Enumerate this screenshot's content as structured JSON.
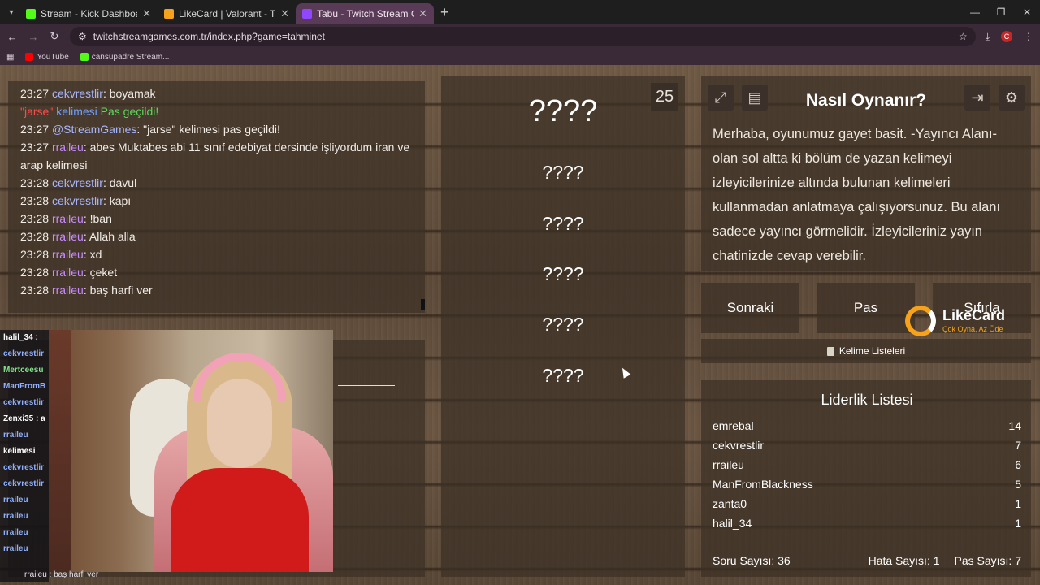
{
  "browser": {
    "tabs": [
      {
        "title": "Stream - Kick Dashboard",
        "favicon_color": "#53fc18"
      },
      {
        "title": "LikeCard | Valorant - TR",
        "favicon_color": "#f6a21b"
      },
      {
        "title": "Tabu - Twitch Stream Games",
        "favicon_color": "#9146ff"
      }
    ],
    "url": "twitchstreamgames.com.tr/index.php?game=tahminet",
    "bookmarks": [
      {
        "label": "YouTube",
        "favicon_color": "#ff0000"
      },
      {
        "label": "cansupadre Stream...",
        "favicon_color": "#53fc18"
      }
    ],
    "avatar_letter": "C"
  },
  "chat": {
    "lines": [
      {
        "time": "23:27",
        "user": "cekvrestlir",
        "msg": ": boyamak"
      },
      {
        "time": "23:27",
        "user": "@StreamGames",
        "msg": ": \"jarse\" kelimesi pas geçildi!"
      },
      {
        "time": "23:27",
        "user": "rraileu",
        "msg": ": abes Muktabes abi 11 sınıf edebiyat dersinde işliyordum iran ve arap kelimesi"
      },
      {
        "time": "23:28",
        "user": "cekvrestlir",
        "msg": ": davul"
      },
      {
        "time": "23:28",
        "user": "cekvrestlir",
        "msg": ": kapı"
      },
      {
        "time": "23:28",
        "user": "rraileu",
        "msg": ": !ban"
      },
      {
        "time": "23:28",
        "user": "rraileu",
        "msg": ": Allah alla"
      },
      {
        "time": "23:28",
        "user": "rraileu",
        "msg": ": xd"
      },
      {
        "time": "23:28",
        "user": "rraileu",
        "msg": ": çeket"
      },
      {
        "time": "23:28",
        "user": "rraileu",
        "msg": ": baş harfi ver"
      }
    ],
    "notice": {
      "word": "\"jarse\"",
      "middle": "kelimesi",
      "status": "Pas geçildi!"
    }
  },
  "words": {
    "timer": "25",
    "main": "????",
    "list": [
      "????",
      "????",
      "????",
      "????",
      "????"
    ]
  },
  "howto": {
    "title": "Nasıl Oynanır?",
    "text": "Merhaba, oyunumuz gayet basit. -Yayıncı Alanı- olan sol altta ki bölüm de yazan kelimeyi izleyicilerinize altında bulunan kelimeleri kullanmadan anlatmaya çalışıyorsunuz. Bu alanı sadece yayıncı görmelidir. İzleyicileriniz yayın chatinizde cevap verebilir."
  },
  "buttons": {
    "next": "Sonraki",
    "pass": "Pas",
    "reset": "Sıfırla",
    "lists": "Kelime Listeleri"
  },
  "sponsor": {
    "name": "LikeCard",
    "tagline": "Çok Oyna, Az Öde"
  },
  "leaderboard": {
    "title": "Liderlik Listesi",
    "rows": [
      {
        "name": "emrebal",
        "score": "14"
      },
      {
        "name": "cekvrestlir",
        "score": "7"
      },
      {
        "name": "rraileu",
        "score": "6"
      },
      {
        "name": "ManFromBlackness",
        "score": "5"
      },
      {
        "name": "zanta0",
        "score": "1"
      },
      {
        "name": "halil_34",
        "score": "1"
      }
    ],
    "stats": {
      "questions": "Soru Sayısı: 36",
      "errors": "Hata Sayısı: 1",
      "passes": "Pas Sayısı: 7"
    }
  },
  "overlay_chat": {
    "lines": [
      "halil_34 :",
      "cekvrestlir",
      "Mertceesu",
      "ManFromB",
      "cekvrestlir",
      "Zenxi35 : a",
      "rraileu",
      "kelimesi",
      "cekvrestlir",
      "cekvrestlir",
      "rraileu",
      "rraileu",
      "rraileu",
      "rraileu"
    ],
    "bottom": "rraileu : baş harfi ver"
  }
}
